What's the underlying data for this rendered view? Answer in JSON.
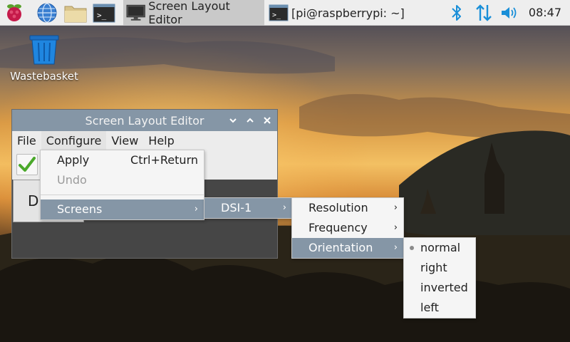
{
  "taskbar": {
    "apps": [
      {
        "icon": "raspberry-pi-menu-icon"
      },
      {
        "icon": "web-browser-icon"
      },
      {
        "icon": "file-manager-icon"
      },
      {
        "icon": "terminal-icon"
      }
    ],
    "tasks": [
      {
        "label": "Screen Layout Editor",
        "icon": "monitor-icon",
        "active": true
      },
      {
        "label": "[pi@raspberrypi: ~]",
        "icon": "terminal-icon",
        "active": false
      }
    ],
    "tray": [
      "bluetooth-icon",
      "network-icon",
      "volume-icon"
    ],
    "clock": "08:47"
  },
  "desktop": {
    "icons": [
      {
        "label": "Wastebasket",
        "icon": "wastebasket-icon"
      }
    ]
  },
  "window": {
    "title": "Screen Layout Editor",
    "controls": [
      "minimize-icon",
      "maximize-icon",
      "close-icon"
    ],
    "menubar": [
      "File",
      "Configure",
      "View",
      "Help"
    ],
    "screen_label": "D"
  },
  "configure_menu": {
    "items": [
      {
        "label": "Apply",
        "accel": "Ctrl+Return"
      },
      {
        "label": "Undo",
        "disabled": true
      },
      {
        "label": "Screens",
        "submenu": true,
        "highlighted": true
      }
    ]
  },
  "screens_menu": {
    "items": [
      {
        "label": "DSI-1",
        "submenu": true,
        "highlighted": true
      }
    ]
  },
  "dsi_menu": {
    "items": [
      {
        "label": "Resolution",
        "submenu": true
      },
      {
        "label": "Frequency",
        "submenu": true
      },
      {
        "label": "Orientation",
        "submenu": true,
        "highlighted": true
      }
    ]
  },
  "orientation_menu": {
    "selected": "normal",
    "items": [
      {
        "label": "normal"
      },
      {
        "label": "right"
      },
      {
        "label": "inverted"
      },
      {
        "label": "left"
      }
    ]
  },
  "colors": {
    "highlight": "#8596a6",
    "taskbar": "#eeeeee",
    "accent_blue": "#1a8fd8"
  }
}
